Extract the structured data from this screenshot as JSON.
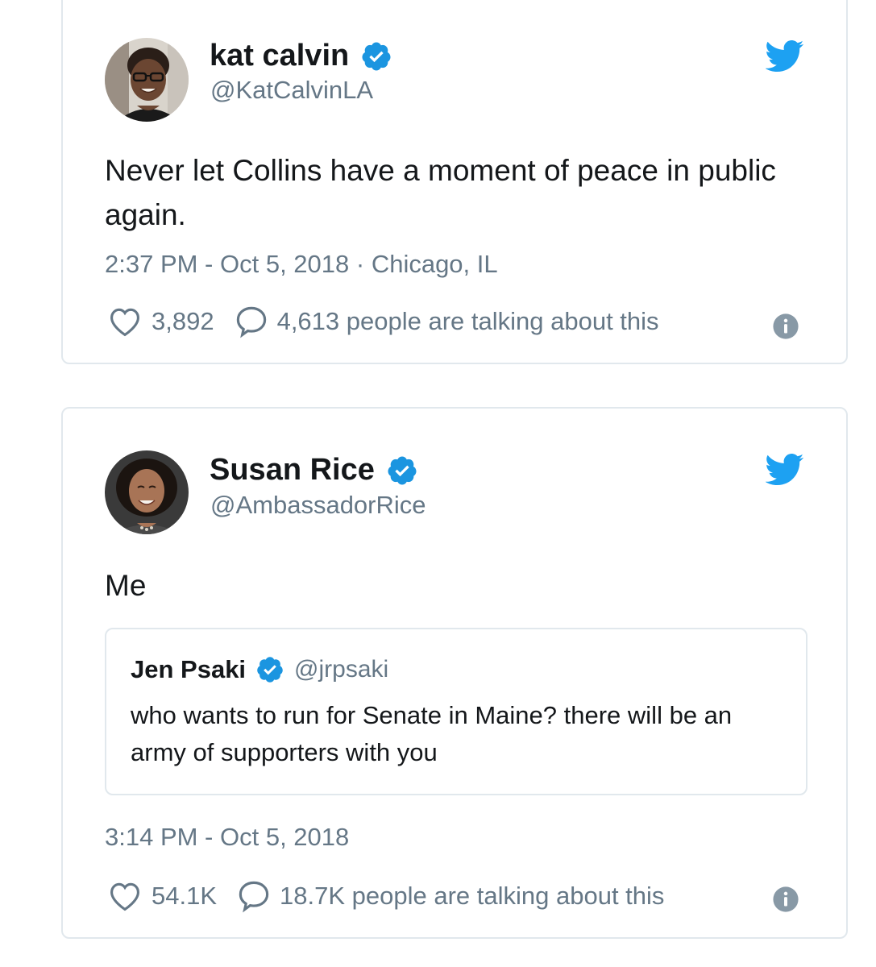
{
  "tweets": [
    {
      "name": "kat calvin",
      "handle": "@KatCalvinLA",
      "verified": true,
      "text": "Never let Collins have a moment of peace in public again.",
      "meta": "2:37 PM - Oct 5, 2018 · Chicago, IL",
      "likes": "3,892",
      "talking": "4,613 people are talking about this",
      "icons": [
        "avatar",
        "verified-badge-icon",
        "twitter-bird-icon",
        "heart-icon",
        "reply-bubble-icon",
        "info-icon"
      ]
    },
    {
      "name": "Susan Rice",
      "handle": "@AmbassadorRice",
      "verified": true,
      "text": "Me",
      "meta": "3:14 PM - Oct 5, 2018",
      "likes": "54.1K",
      "talking": "18.7K people are talking about this",
      "quote": {
        "name": "Jen Psaki",
        "handle": "@jrpsaki",
        "verified": true,
        "text": "who wants to run for Senate in Maine? there will be an army of supporters with you"
      },
      "icons": [
        "avatar",
        "verified-badge-icon",
        "twitter-bird-icon",
        "heart-icon",
        "reply-bubble-icon",
        "info-icon"
      ]
    }
  ],
  "colors": {
    "text": "#14171a",
    "secondary": "#657786",
    "border": "#e1e8ed",
    "twitter_blue": "#1da1f2",
    "verified_blue": "#1b95e0",
    "info_gray": "#8899a6"
  }
}
